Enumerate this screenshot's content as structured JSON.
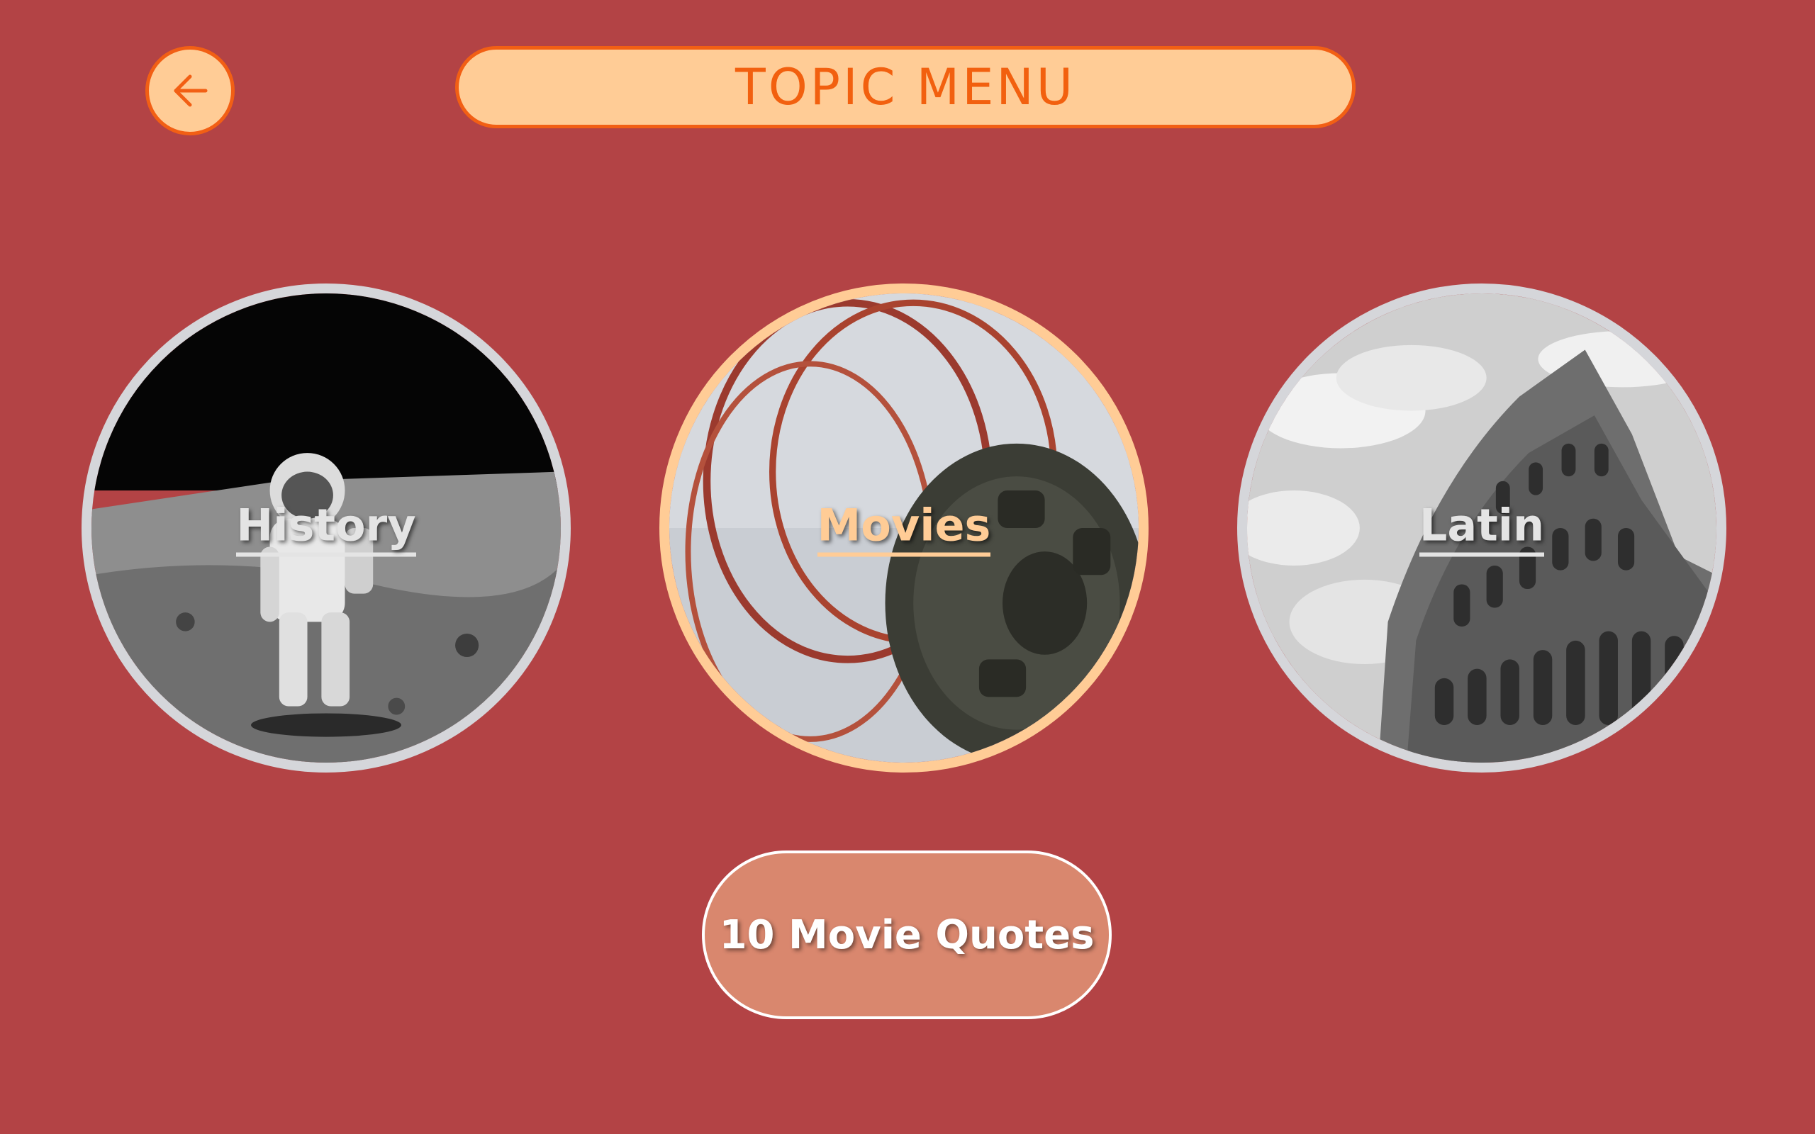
{
  "header": {
    "back_icon": "arrow-left-icon",
    "title": "TOPIC  MENU"
  },
  "topics": [
    {
      "label": "History",
      "image": "astronaut-on-moon"
    },
    {
      "label": "Movies",
      "image": "film-reel"
    },
    {
      "label": "Latin",
      "image": "colosseum"
    }
  ],
  "action_button": {
    "label": "10 Movie Quotes"
  },
  "colors": {
    "background": "#b34345",
    "accent": "#f25f14",
    "pale_orange": "#ffcc96",
    "button_fill": "#d9876e"
  }
}
